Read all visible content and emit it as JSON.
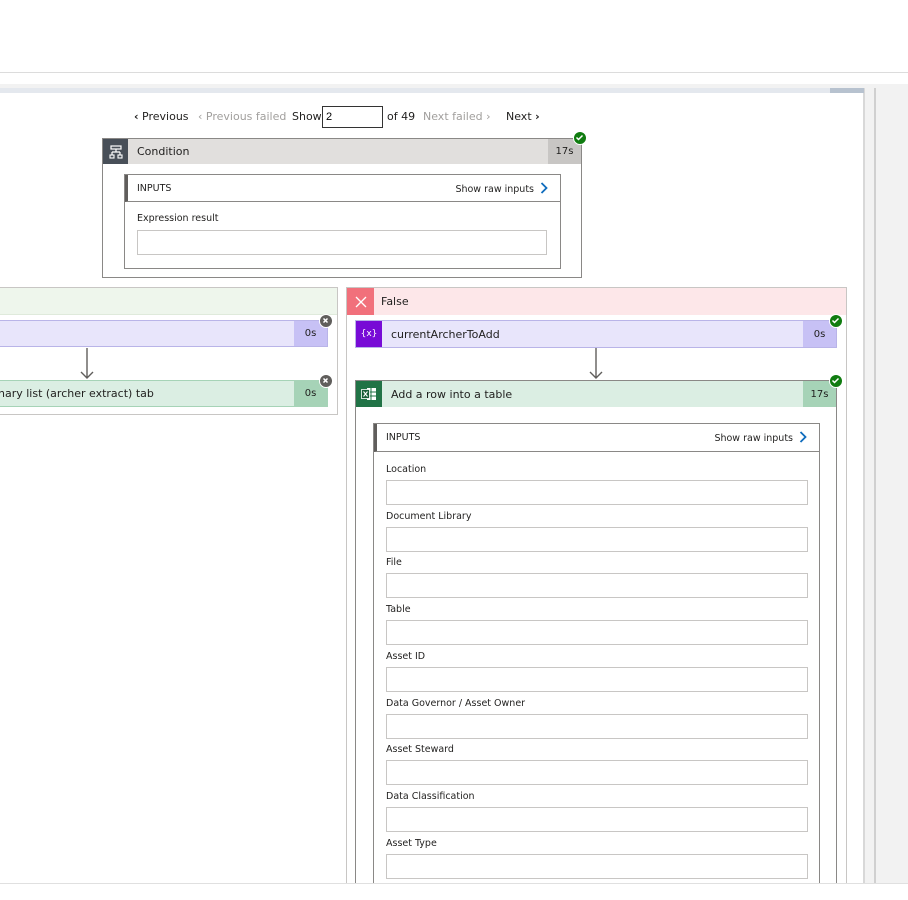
{
  "pager": {
    "previous": "Previous",
    "previous_failed": "Previous failed",
    "show": "Show",
    "current": "2",
    "of_total": "of 49",
    "next_failed": "Next failed",
    "next": "Next"
  },
  "condition": {
    "title": "Condition",
    "duration": "17s",
    "inputs_label": "INPUTS",
    "show_raw": "Show raw inputs",
    "field": "Expression result"
  },
  "left_branch": {
    "action1_duration": "0s",
    "action2_title": "nary list (archer extract) tab",
    "action2_duration": "0s"
  },
  "false_branch": {
    "label": "False",
    "variable_action": {
      "title": "currentArcherToAdd",
      "duration": "0s"
    },
    "excel_action": {
      "title": "Add a row into a table",
      "duration": "17s",
      "inputs_label": "INPUTS",
      "show_raw": "Show raw inputs",
      "fields": [
        "Location",
        "Document Library",
        "File",
        "Table",
        "Asset ID",
        "Data Governor / Asset Owner",
        "Asset Steward",
        "Data Classification",
        "Asset Type"
      ]
    }
  },
  "colors": {
    "condition_header": "#e1dfdd",
    "condition_icon": "#484f58",
    "variable_header": "#e8e5fb",
    "variable_icon": "#770bd6",
    "variable_duration": "#c7c1f5",
    "excel_header": "#dbeee3",
    "excel_icon": "#217346",
    "excel_duration": "#a6d3b7",
    "success": "#107c10",
    "false_bg": "#fde7e9",
    "false_icon": "#f1707b",
    "true_bg": "#eef6ec"
  }
}
